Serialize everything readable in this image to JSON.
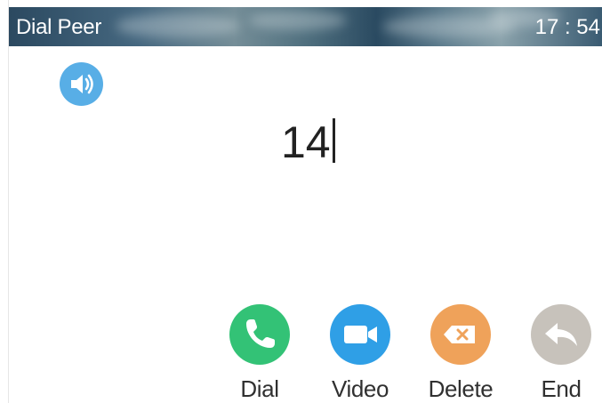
{
  "status_bar": {
    "title": "Dial Peer",
    "time": "17 : 54"
  },
  "indicators": {
    "audio_icon": "speaker-icon"
  },
  "dial": {
    "number": "14"
  },
  "softkeys": [
    {
      "label": "Dial",
      "icon": "phone-icon",
      "color": "#33c276"
    },
    {
      "label": "Video",
      "icon": "video-camera-icon",
      "color": "#2f9fe6"
    },
    {
      "label": "Delete",
      "icon": "backspace-icon",
      "color": "#efa25a"
    },
    {
      "label": "End",
      "icon": "return-arrow-icon",
      "color": "#c7c2bb"
    }
  ]
}
